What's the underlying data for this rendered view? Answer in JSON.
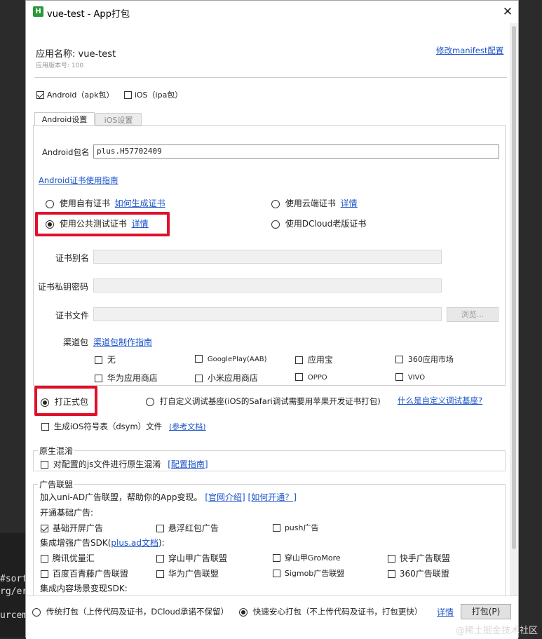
{
  "background_text": [
    "#sort",
    "rg/er",
    "urcem"
  ],
  "dialog": {
    "icon_letter": "H",
    "title": "vue-test - App打包",
    "close_glyph": "✕"
  },
  "header": {
    "app_name": "应用名称: vue-test",
    "app_version": "应用版本号: 100",
    "edit_manifest_link": "修改manifest配置"
  },
  "platforms": {
    "android": "Android（apk包）",
    "ios": "iOS（ipa包）"
  },
  "tabs": {
    "android": "Android设置",
    "ios": "iOS设置"
  },
  "android": {
    "package_label": "Android包名",
    "package_value": "plus.H57702409",
    "cert_guide_link": "Android证书使用指南",
    "cert_options": {
      "own": "使用自有证书",
      "own_link": "如何生成证书",
      "cloud": "使用云端证书",
      "cloud_link": "详情",
      "public_test": "使用公共测试证书",
      "public_test_link": "详情",
      "dcloud_old": "使用DCloud老版证书"
    },
    "cert_alias_label": "证书别名",
    "cert_password_label": "证书私钥密码",
    "cert_file_label": "证书文件",
    "browse_button": "浏览...",
    "channel_label": "渠道包",
    "channel_link": "渠道包制作指南",
    "channels": [
      "无",
      "GooglePlay(AAB)",
      "应用宝",
      "360应用市场",
      "华为应用商店",
      "小米应用商店",
      "OPPO",
      "VIVO"
    ]
  },
  "build_type": {
    "release": "打正式包",
    "custom_debug": "打自定义调试基座(iOS的Safari调试需要用苹果开发证书打包)",
    "custom_debug_link": "什么是自定义调试基座?"
  },
  "ios_symbols": {
    "label": "生成iOS符号表（dsym）文件",
    "link": "(参考文档)"
  },
  "native_obfuscation": {
    "title": "原生混淆",
    "option": "对配置的js文件进行原生混淆",
    "link": "[配置指南]"
  },
  "ads": {
    "title": "广告联盟",
    "intro": "加入uni-AD广告联盟，帮助你的App变现。",
    "intro_link1": "[官网介绍]",
    "intro_link2": "[如何开通？]",
    "basic_label": "开通基础广告:",
    "basic": [
      "基础开屏广告",
      "悬浮红包广告",
      "push广告"
    ],
    "sdk_label_prefix": "集成增强广告SDK(",
    "sdk_link": "plus.ad文档",
    "sdk_label_suffix": "):",
    "sdk": [
      "腾讯优量汇",
      "穿山甲广告联盟",
      "穿山甲GroMore",
      "快手广告联盟",
      "百度百青藤广告联盟",
      "华为广告联盟",
      "Sigmob广告联盟",
      "360广告联盟"
    ],
    "content_label": "集成内容场景变现SDK:"
  },
  "bottom": {
    "traditional": "传统打包（上传代码及证书，DCloud承诺不保留）",
    "fast": "快速安心打包（不上传代码及证书，打包更快）",
    "details_link": "详情",
    "pack_button": "打包(P)"
  },
  "watermark": "@稀土掘金技术社区"
}
